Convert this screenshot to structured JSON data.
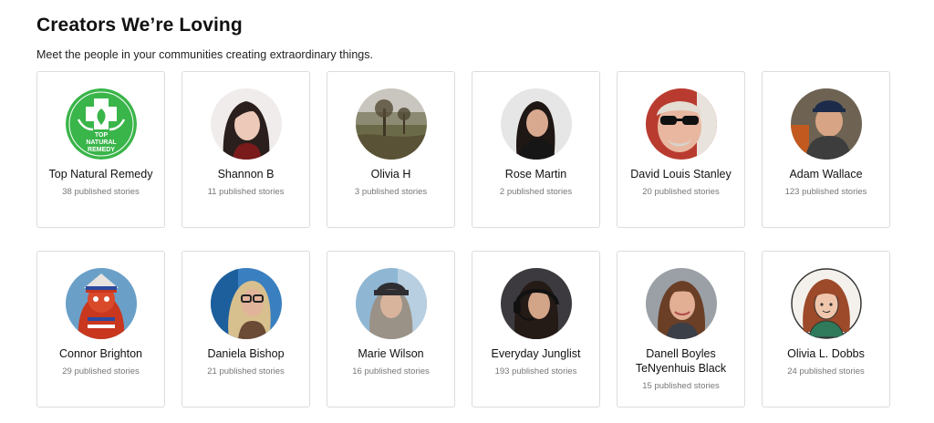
{
  "header": {
    "title": "Creators We’re Loving",
    "subtitle": "Meet the people in your communities creating extraordinary things."
  },
  "creators": [
    {
      "name": "Top Natural Remedy",
      "stories": "38 published stories",
      "avatar": "logo"
    },
    {
      "name": "Shannon B",
      "stories": "11 published stories",
      "avatar": "person"
    },
    {
      "name": "Olivia H",
      "stories": "3 published stories",
      "avatar": "landscape"
    },
    {
      "name": "Rose Martin",
      "stories": "2 published stories",
      "avatar": "person"
    },
    {
      "name": "David Louis Stanley",
      "stories": "20 published stories",
      "avatar": "person"
    },
    {
      "name": "Adam Wallace",
      "stories": "123 published stories",
      "avatar": "person"
    },
    {
      "name": "Connor Brighton",
      "stories": "29 published stories",
      "avatar": "mascot"
    },
    {
      "name": "Daniela Bishop",
      "stories": "21 published stories",
      "avatar": "person"
    },
    {
      "name": "Marie Wilson",
      "stories": "16 published stories",
      "avatar": "person"
    },
    {
      "name": "Everyday Junglist",
      "stories": "193 published stories",
      "avatar": "person"
    },
    {
      "name": "Danell Boyles TeNyenhuis Black",
      "stories": "15 published stories",
      "avatar": "person"
    },
    {
      "name": "Olivia L. Dobbs",
      "stories": "24 published stories",
      "avatar": "illustration"
    }
  ],
  "logo_text": [
    "TOP",
    "NATURAL",
    "REMEDY"
  ],
  "colors": {
    "logo_green": "#3ab54a",
    "card_border": "#dcdcdc",
    "muted_text": "#777777"
  }
}
